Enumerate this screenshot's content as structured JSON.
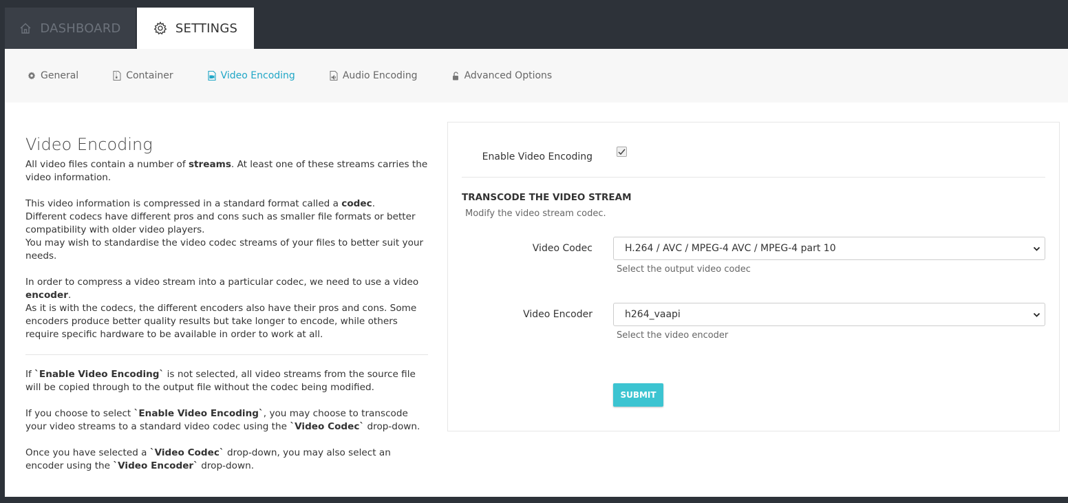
{
  "top_tabs": [
    {
      "label": "DASHBOARD",
      "icon": "home-icon",
      "active": false
    },
    {
      "label": "SETTINGS",
      "icon": "gear-icon",
      "active": true
    }
  ],
  "subnav": [
    {
      "label": "General",
      "icon": "cog-icon"
    },
    {
      "label": "Container",
      "icon": "file-archive-icon"
    },
    {
      "label": "Video Encoding",
      "icon": "file-video-icon",
      "active": true
    },
    {
      "label": "Audio Encoding",
      "icon": "file-audio-icon"
    },
    {
      "label": "Advanced Options",
      "icon": "unlock-icon"
    }
  ],
  "colors": {
    "accent": "#1fa6c6",
    "submit_bg": "#3cc4d1",
    "frame_bg": "#2d3239"
  },
  "info": {
    "title": "Video Encoding",
    "p1_a": "All video files contain a number of ",
    "p1_b": "streams",
    "p1_c": ". At least one of these streams carries the video information.",
    "p2_a": "This video information is compressed in a standard format called a ",
    "p2_b": "codec",
    "p2_c": ".",
    "p2_d": "Different codecs have different pros and cons such as smaller file formats or better compatibility with older video players.",
    "p2_e": "You may wish to standardise the video codec streams of your files to better suit your needs.",
    "p3_a": "In order to compress a video stream into a particular codec, we need to use a video ",
    "p3_b": "encoder",
    "p3_c": ".",
    "p3_d": "As it is with the codecs, the different encoders also have their pros and cons. Some encoders produce better quality results but take longer to encode, while others require specific hardware to be available in order to work at all.",
    "p4_a": "If ",
    "p4_b": "`Enable Video Encoding`",
    "p4_c": " is not selected, all video streams from the source file will be copied through to the output file without the codec being modified.",
    "p5_a": "If you choose to select ",
    "p5_b": "`Enable Video Encoding`",
    "p5_c": ", you may choose to transcode your video streams to a standard video codec using the ",
    "p5_d": "`Video Codec`",
    "p5_e": " drop-down.",
    "p6_a": "Once you have selected a ",
    "p6_b": "`Video Codec`",
    "p6_c": " drop-down, you may also select an encoder using the ",
    "p6_d": "`Video Encoder`",
    "p6_e": " drop-down."
  },
  "form": {
    "enable_label": "Enable Video Encoding",
    "enable_checked": true,
    "section_title": "TRANSCODE THE VIDEO STREAM",
    "section_desc": "Modify the video stream codec.",
    "codec_label": "Video Codec",
    "codec_value": "H.264 / AVC / MPEG-4 AVC / MPEG-4 part 10",
    "codec_help": "Select the output video codec",
    "encoder_label": "Video Encoder",
    "encoder_value": "h264_vaapi",
    "encoder_help": "Select the video encoder",
    "submit_label": "SUBMIT"
  }
}
